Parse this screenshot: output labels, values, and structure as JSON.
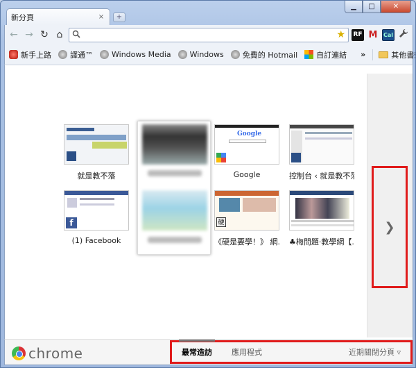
{
  "window": {
    "controls": {
      "minimize": "▁",
      "maximize": "□",
      "close": "✕"
    }
  },
  "tab": {
    "title": "新分頁",
    "close": "×",
    "new_tab": "+"
  },
  "toolbar": {
    "back": "←",
    "forward": "→",
    "reload": "↻",
    "home": "⌂",
    "address_value": "",
    "star": "★",
    "extensions": [
      "RF",
      "M",
      "Cal"
    ],
    "wrench": "🔧"
  },
  "bookmarks": {
    "items": [
      {
        "label": "新手上路",
        "icon": "red-icon"
      },
      {
        "label": "譯通™",
        "icon": "globe-icon"
      },
      {
        "label": "Windows Media",
        "icon": "globe-icon"
      },
      {
        "label": "Windows",
        "icon": "globe-icon"
      },
      {
        "label": "免費的 Hotmail",
        "icon": "globe-icon"
      },
      {
        "label": "自訂連結",
        "icon": "windows-icon"
      }
    ],
    "overflow": "»",
    "other_folder": "其他書籤"
  },
  "thumbnails": [
    {
      "label": "就是教不落"
    },
    {
      "label": ""
    },
    {
      "label": "Google"
    },
    {
      "label": "控制台 ‹ 就是教不落"
    },
    {
      "label": "(1) Facebook"
    },
    {
      "label": ""
    },
    {
      "label": "《硬是要學！》 網..."
    },
    {
      "label": "♣梅問題‧教學網【..."
    }
  ],
  "next_page": "❯",
  "footer": {
    "logo": "chrome",
    "tabs": {
      "most_visited": "最常造訪",
      "apps": "應用程式"
    },
    "recently_closed": "近期關閉分頁 ▿"
  }
}
